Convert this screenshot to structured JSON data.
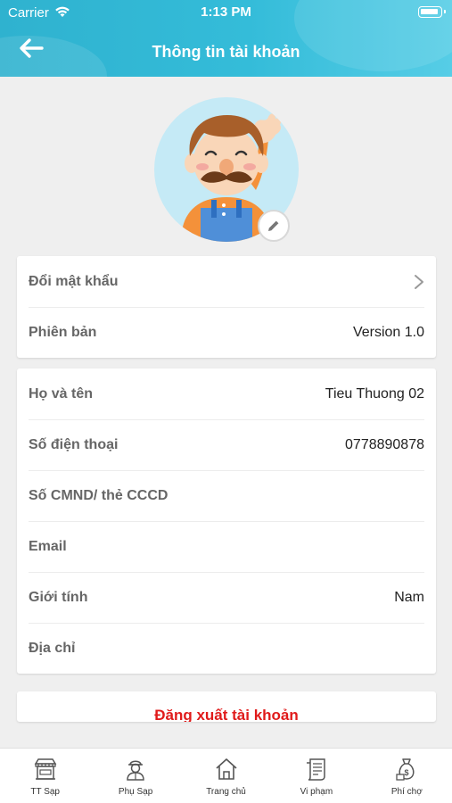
{
  "status_bar": {
    "carrier": "Carrier",
    "time": "1:13 PM"
  },
  "header": {
    "title": "Thông tin tài khoản",
    "back_icon": "arrow-left-icon"
  },
  "colors": {
    "header": "#34bcd9",
    "logout": "#e01b1b",
    "label": "#666666"
  },
  "settings": [
    {
      "label": "Đổi mật khẩu",
      "value": "",
      "icon": "chevron-right-icon"
    },
    {
      "label": "Phiên bản",
      "value": "Version 1.0"
    }
  ],
  "profile": [
    {
      "label": "Họ và tên",
      "value": "Tieu Thuong 02"
    },
    {
      "label": "Số điện thoại",
      "value": "0778890878"
    },
    {
      "label": "Số CMND/ thẻ CCCD",
      "value": ""
    },
    {
      "label": "Email",
      "value": ""
    },
    {
      "label": "Giới tính",
      "value": "Nam"
    },
    {
      "label": "Địa chỉ",
      "value": ""
    }
  ],
  "logout_label": "Đăng xuất tài khoản",
  "tabs": [
    {
      "label": "TT Sạp",
      "icon": "stall-icon"
    },
    {
      "label": "Phụ Sạp",
      "icon": "assistant-icon"
    },
    {
      "label": "Trang chủ",
      "icon": "home-icon"
    },
    {
      "label": "Vi phạm",
      "icon": "violation-icon"
    },
    {
      "label": "Phí chợ",
      "icon": "fee-icon"
    }
  ]
}
